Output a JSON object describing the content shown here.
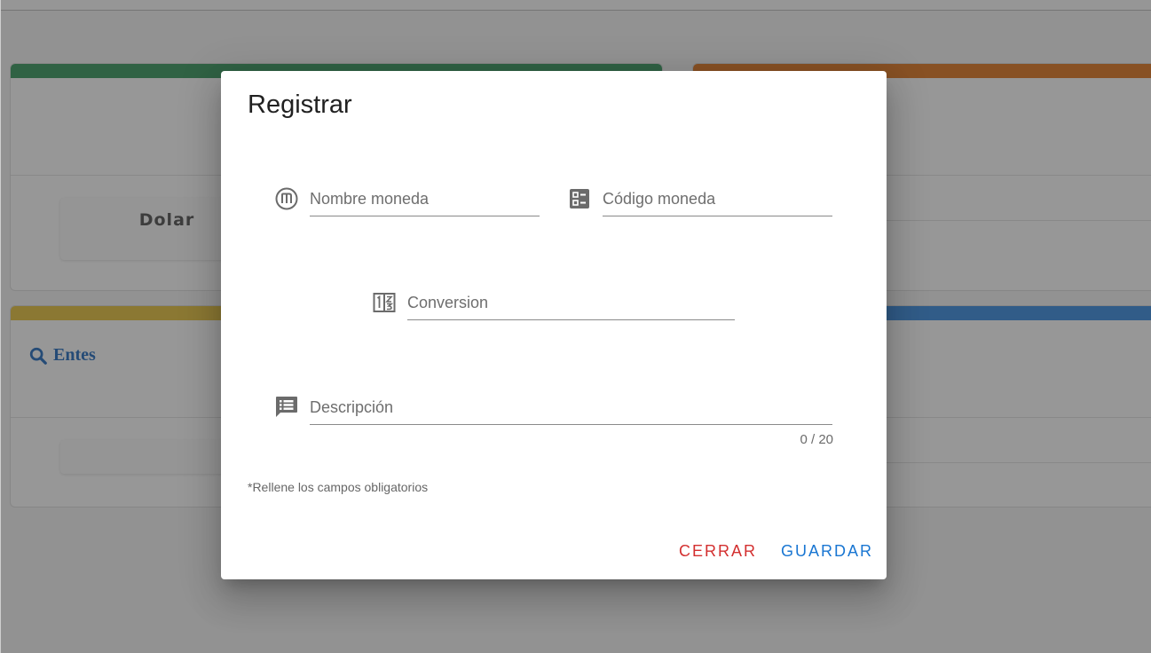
{
  "background": {
    "cards": {
      "green_color": "#3d9a62",
      "orange_color": "#e07a27",
      "yellow_color": "#e6c244",
      "blue_color": "#3f8fe0"
    },
    "dolar_label": "Dolar",
    "entes_label": "Entes"
  },
  "dialog": {
    "title": "Registrar",
    "fields": {
      "nombre": {
        "placeholder": "Nombre moneda",
        "value": ""
      },
      "codigo": {
        "placeholder": "Código moneda",
        "value": ""
      },
      "conversion": {
        "placeholder": "Conversion",
        "value": ""
      },
      "descripcion": {
        "placeholder": "Descripción",
        "value": ""
      }
    },
    "counter": "0 / 20",
    "hint": "*Rellene los campos obligatorios",
    "buttons": {
      "close_label": "Cerrar",
      "close_color": "#d32f2f",
      "save_label": "Guardar",
      "save_color": "#1976d2"
    }
  }
}
